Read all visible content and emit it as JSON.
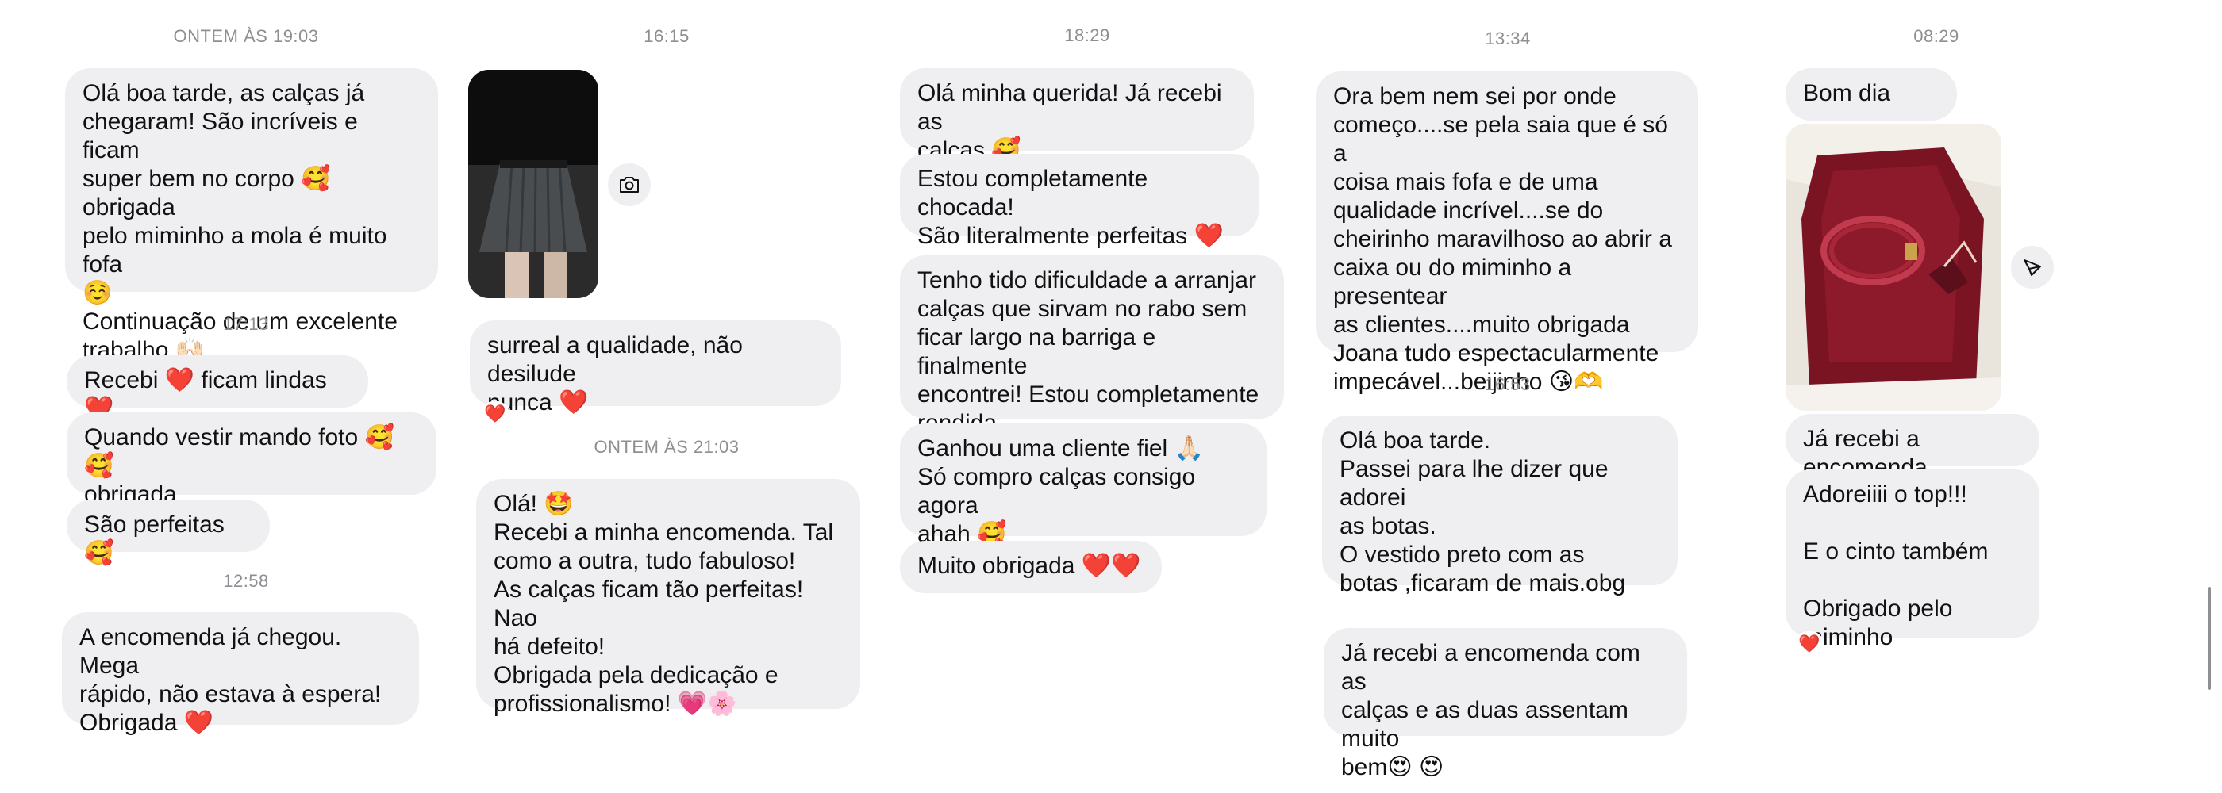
{
  "colors": {
    "bubble_bg": "#efeff1",
    "timestamp": "#8e8e93",
    "heart": "#e0161b",
    "background": "#ffffff"
  },
  "columns": [
    {
      "timestamps": [
        "ONTEM ÀS 19:03",
        "17:13",
        "12:58"
      ],
      "messages": [
        "Olá boa tarde, as calças já\nchegaram! São incríveis e ficam\nsuper bem no corpo 🥰 obrigada\npelo miminho a mola é muito fofa\n☺️\nContinuação de um excelente\ntrabalho 🙌🏻",
        "Recebi ❤️ ficam lindas ❤️",
        "Quando vestir mando foto 🥰🥰\nobrigada",
        "São perfeitas 🥰",
        "A encomenda já chegou. Mega\nrápido, não estava à espera!\nObrigada ❤️"
      ]
    },
    {
      "timestamps": [
        "16:15",
        "ONTEM ÀS 21:03"
      ],
      "messages": [
        "surreal a qualidade, não desilude\nnunca ❤️",
        "Olá! 🤩\nRecebi a minha encomenda. Tal\ncomo a outra, tudo fabuloso!\nAs calças ficam tão perfeitas! Nao\nhá defeito!\nObrigada pela dedicação e\nprofissionalismo! 💗🌸"
      ],
      "reaction": "❤️",
      "camera_icon": "camera-icon"
    },
    {
      "timestamps": [
        "18:29"
      ],
      "messages": [
        "Olá minha querida! Já recebi as\ncalças 🥰",
        "Estou completamente chocada!\nSão literalmente perfeitas ❤️",
        "Tenho tido dificuldade a arranjar\ncalças que sirvam no rabo sem\nficar largo na barriga e finalmente\nencontrei! Estou completamente\nrendida",
        "Ganhou uma cliente fiel 🙏🏻\nSó compro calças consigo agora\nahah 🥰",
        "Muito obrigada ❤️❤️"
      ]
    },
    {
      "timestamps": [
        "13:34",
        "16:53"
      ],
      "messages": [
        "Ora bem nem sei por onde\ncomeço....se pela saia que é só a\ncoisa mais fofa e de uma\nqualidade incrível....se do\ncheirinho maravilhoso ao abrir a\ncaixa ou do miminho a presentear\nas clientes....muito obrigada\nJoana tudo espectacularmente\nimpecável...beijinho 😘🫶",
        "Olá boa tarde.\nPassei para lhe dizer que adorei\nas botas.\nO vestido preto com as\nbotas ,ficaram de mais.obg",
        "Já recebi a encomenda com as\ncalças e as duas assentam muito\nbem😍 😍"
      ]
    },
    {
      "timestamps": [
        "08:29"
      ],
      "messages": [
        "Bom dia",
        "Já recebi a encomenda",
        "Adoreiiii o top!!!\n\nE o cinto também\n\nObrigado pelo miminho"
      ],
      "reaction": "❤️",
      "share_icon": "send-icon"
    }
  ]
}
